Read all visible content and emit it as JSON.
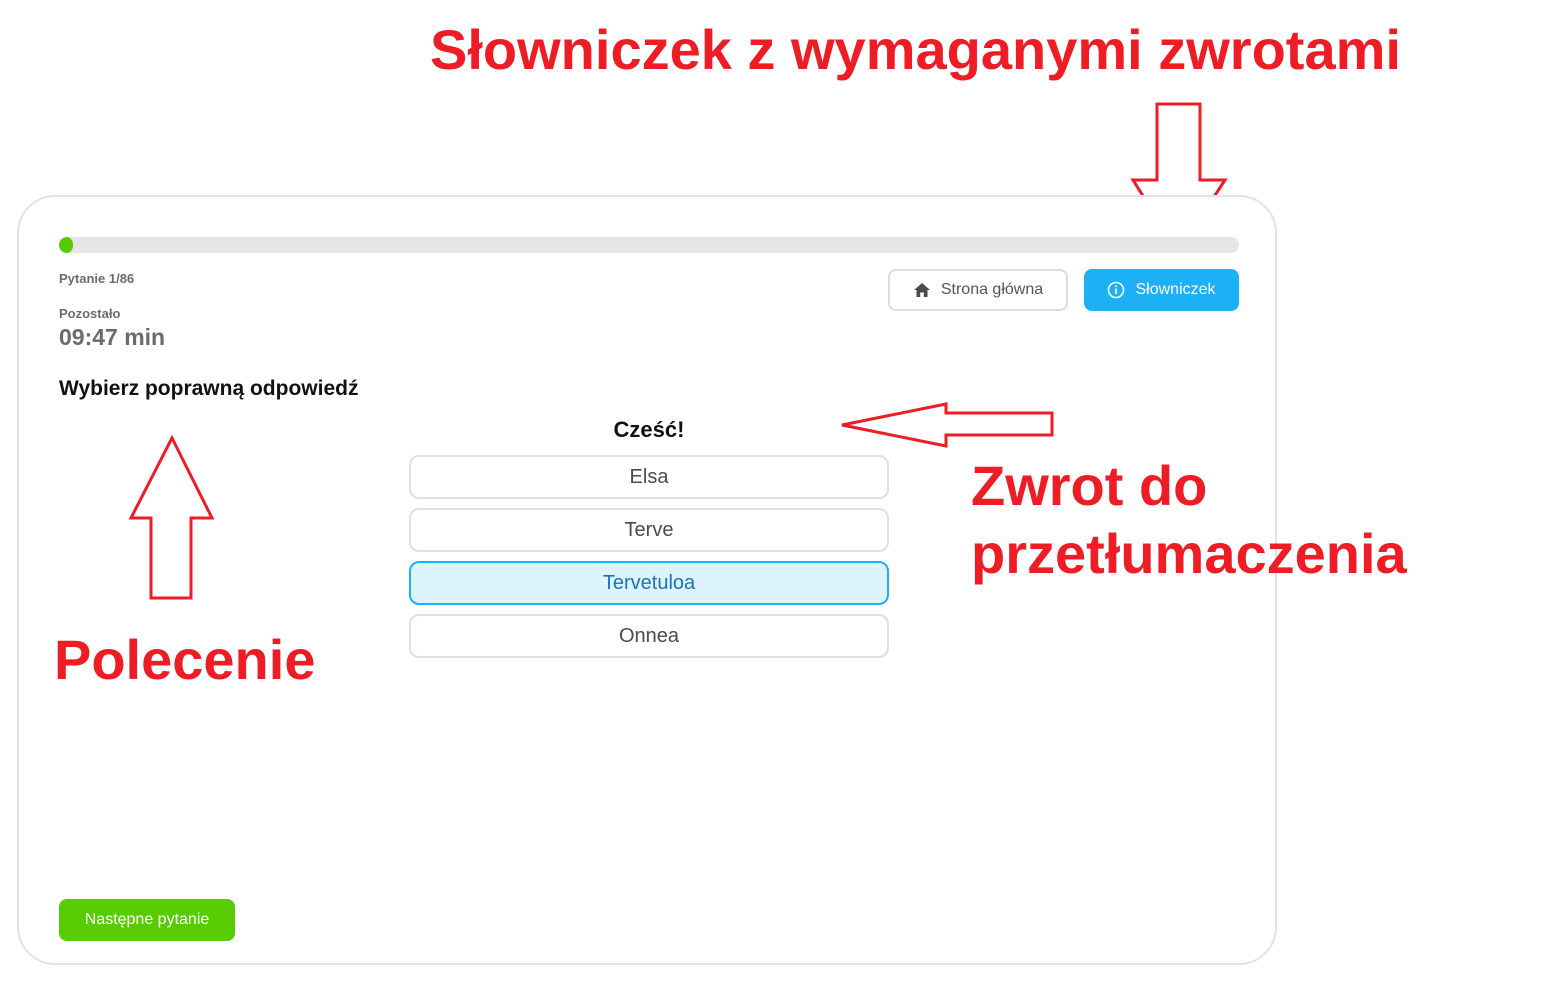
{
  "annotations": {
    "title": "Słowniczek z wymaganymi zwrotami",
    "phrase_note_line1": "Zwrot do",
    "phrase_note_line2": "przetłumaczenia",
    "prompt_note": "Polecenie"
  },
  "quiz": {
    "progress_fraction": 0.0116,
    "question_counter": "Pytanie 1/86",
    "remaining_label": "Pozostało",
    "timer": "09:47 min",
    "instruction": "Wybierz poprawną odpowiedź",
    "phrase": "Cześć!",
    "options": [
      {
        "label": "Elsa",
        "selected": false
      },
      {
        "label": "Terve",
        "selected": false
      },
      {
        "label": "Tervetuloa",
        "selected": true
      },
      {
        "label": "Onnea",
        "selected": false
      }
    ],
    "next_button_label": "Następne pytanie"
  },
  "toolbar": {
    "home_label": "Strona główna",
    "home_icon": "home-icon",
    "glossary_label": "Słowniczek",
    "glossary_icon": "info-icon"
  },
  "colors": {
    "annotation": "#ee1c24",
    "progress": "#55cc00",
    "glossary_button": "#1cb0f6",
    "next_button": "#58cc02",
    "selected_option_bg": "#ddf4ff",
    "selected_option_border": "#1cb0f6"
  }
}
